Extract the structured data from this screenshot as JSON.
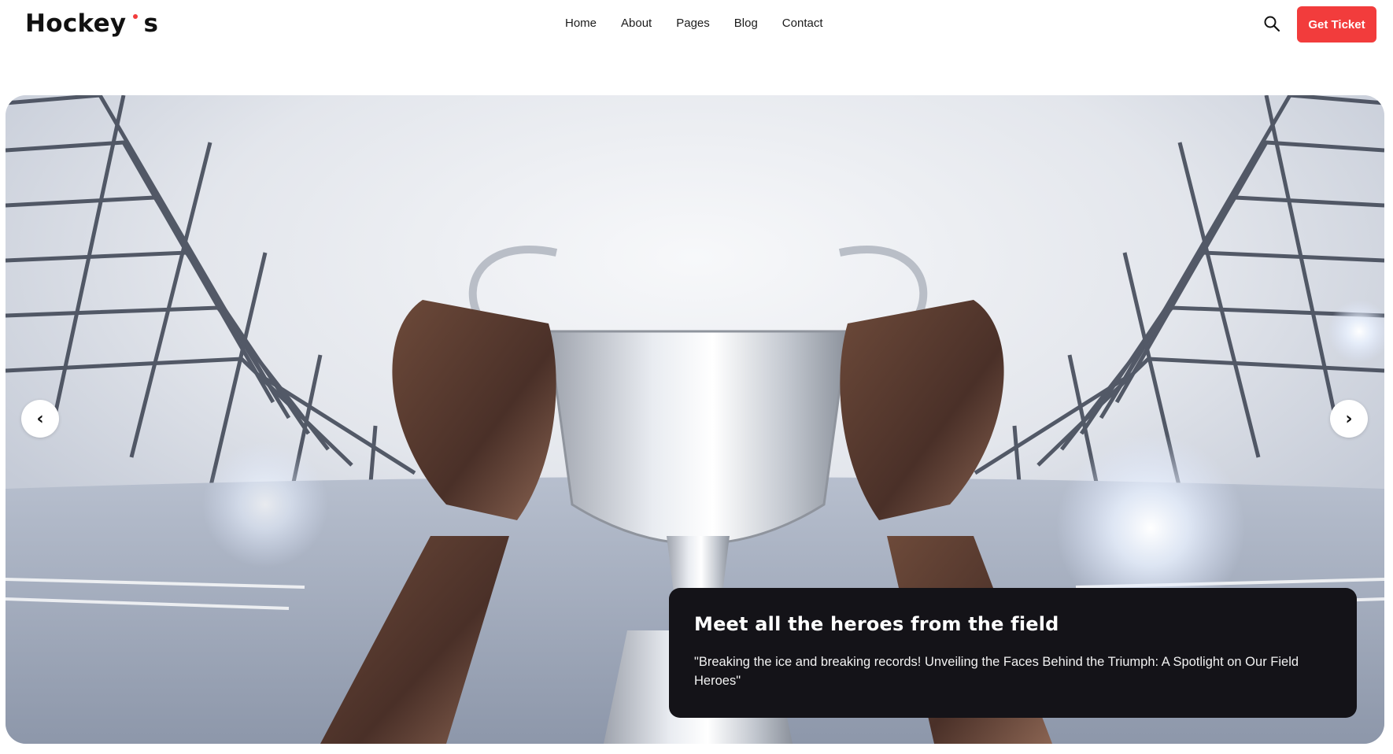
{
  "brand": {
    "name_part1": "Hockey",
    "name_part2": "s",
    "accent_color": "#f23c3c"
  },
  "nav": {
    "items": [
      {
        "label": "Home"
      },
      {
        "label": "About"
      },
      {
        "label": "Pages"
      },
      {
        "label": "Blog"
      },
      {
        "label": "Contact"
      }
    ]
  },
  "header": {
    "search_icon": "search-icon",
    "ticket_label": "Get Ticket",
    "ticket_color": "#f23c3c"
  },
  "hero": {
    "image_description_icon": "trophy-image",
    "prev_icon": "chevron-left-icon",
    "next_icon": "chevron-right-icon",
    "prev_glyph": "‹",
    "next_glyph": "›",
    "caption": {
      "title": "Meet all the heroes from the field",
      "text": "\"Breaking the ice and breaking records! Unveiling the Faces Behind the Triumph: A Spotlight on Our Field Heroes\"",
      "background": "#141318"
    }
  }
}
